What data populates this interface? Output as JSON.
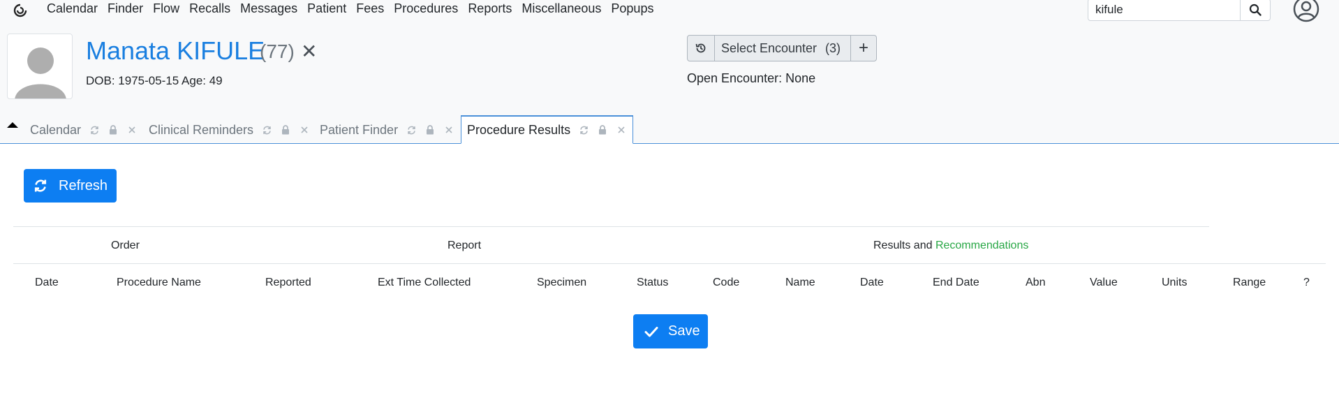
{
  "navbar": {
    "items": [
      "Calendar",
      "Finder",
      "Flow",
      "Recalls",
      "Messages",
      "Patient",
      "Fees",
      "Procedures",
      "Reports",
      "Miscellaneous",
      "Popups"
    ],
    "search_value": "kifule"
  },
  "patient": {
    "name": "Manata KIFULE",
    "count": "(77)",
    "dob": "DOB: 1975-05-15 Age: 49"
  },
  "encounter": {
    "select_label": "Select Encounter",
    "select_count": "(3)",
    "add_label": "+",
    "open_encounter": "Open Encounter: None"
  },
  "tabs": [
    {
      "label": "Calendar"
    },
    {
      "label": "Clinical Reminders"
    },
    {
      "label": "Patient Finder"
    },
    {
      "label": "Procedure Results",
      "active": true
    }
  ],
  "main": {
    "refresh_label": "Refresh",
    "groups": {
      "order": "Order",
      "report": "Report",
      "results_prefix": "Results and",
      "results_highlight": "Recommendations"
    },
    "columns": [
      "Date",
      "Procedure Name",
      "Reported",
      "Ext Time Collected",
      "Specimen",
      "Status",
      "Code",
      "Name",
      "Date",
      "End Date",
      "Abn",
      "Value",
      "Units",
      "Range",
      "?"
    ],
    "save_label": "Save"
  },
  "colors": {
    "brand_blue": "#0d7ef2",
    "patient_name": "#1a7fe0",
    "recommendations_green": "#28a745"
  }
}
